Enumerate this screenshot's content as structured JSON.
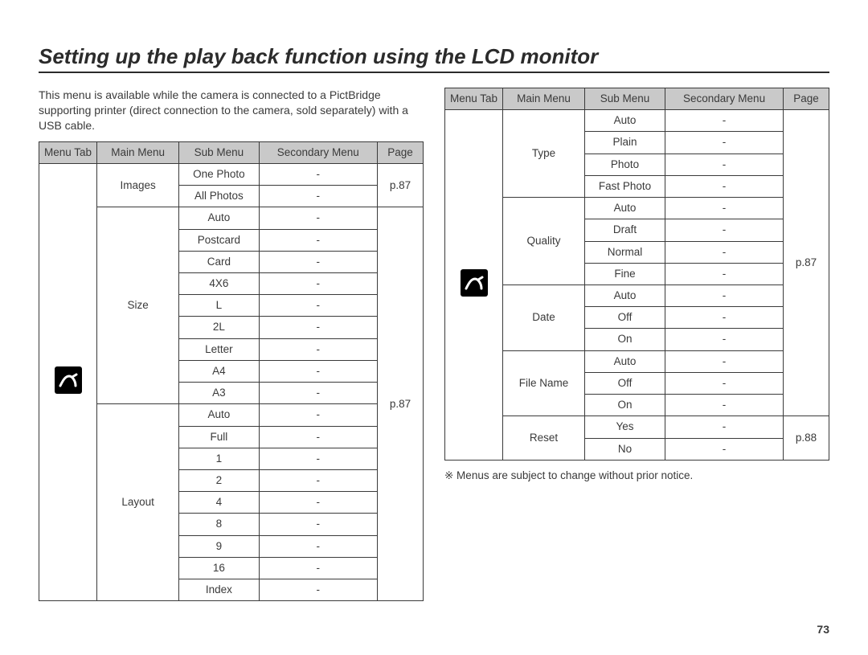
{
  "title": "Setting up the play back function using the LCD monitor",
  "intro": "This menu is available while the camera is connected to a PictBridge supporting printer (direct connection to the camera, sold separately) with a USB cable.",
  "headers": {
    "menutab": "Menu Tab",
    "mainmenu": "Main Menu",
    "submenu": "Sub Menu",
    "secmenu": "Secondary Menu",
    "page": "Page"
  },
  "left": {
    "groups": [
      {
        "name": "Images",
        "subs": [
          "One Photo",
          "All Photos"
        ],
        "page": "p.87"
      },
      {
        "name": "Size",
        "subs": [
          "Auto",
          "Postcard",
          "Card",
          "4X6",
          "L",
          "2L",
          "Letter",
          "A4",
          "A3"
        ],
        "page": ""
      },
      {
        "name": "Layout",
        "subs": [
          "Auto",
          "Full",
          "1",
          "2",
          "4",
          "8",
          "9",
          "16",
          "Index"
        ],
        "page": ""
      }
    ],
    "sizeLayoutPage": "p.87"
  },
  "right": {
    "groups": [
      {
        "name": "Type",
        "subs": [
          "Auto",
          "Plain",
          "Photo",
          "Fast Photo"
        ],
        "page": ""
      },
      {
        "name": "Quality",
        "subs": [
          "Auto",
          "Draft",
          "Normal",
          "Fine"
        ],
        "page": ""
      },
      {
        "name": "Date",
        "subs": [
          "Auto",
          "Off",
          "On"
        ],
        "page": ""
      },
      {
        "name": "File Name",
        "subs": [
          "Auto",
          "Off",
          "On"
        ],
        "page": ""
      },
      {
        "name": "Reset",
        "subs": [
          "Yes",
          "No"
        ],
        "page": "p.88"
      }
    ],
    "firstGroupPage": "p.87"
  },
  "dash": "-",
  "note": "※ Menus are subject to change without prior notice.",
  "pageNumber": "73"
}
